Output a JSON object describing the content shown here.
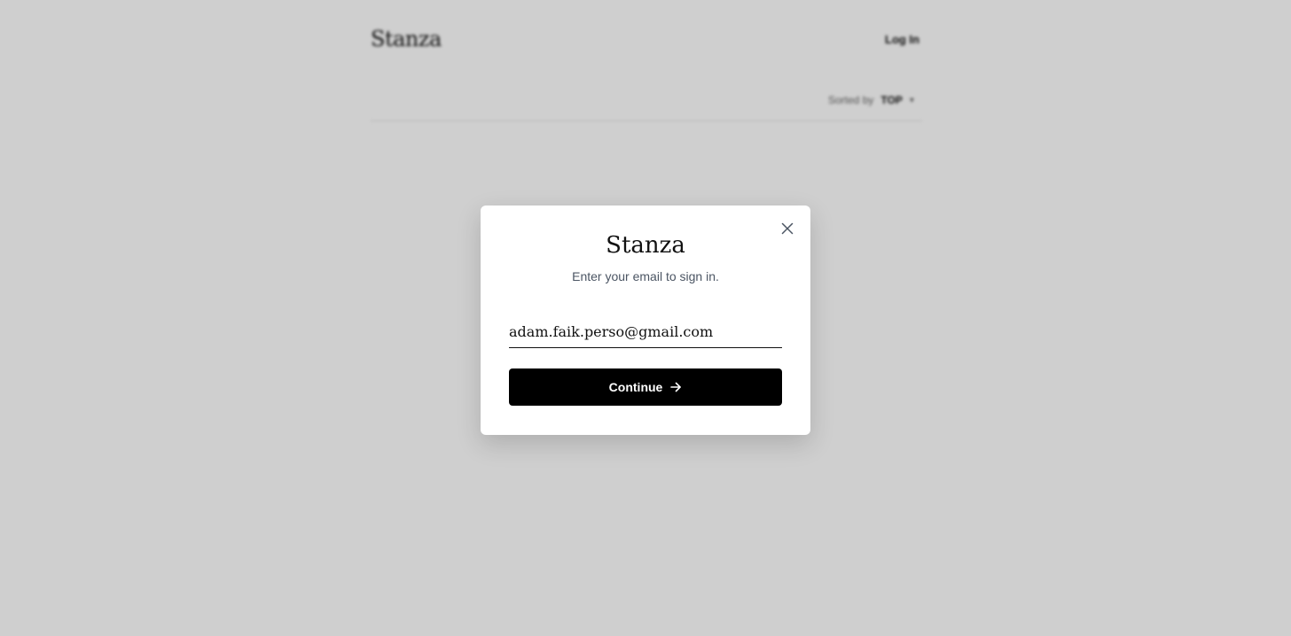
{
  "background": {
    "brand": "Stanza",
    "login_label": "Log In",
    "sort_label": "Sorted by",
    "sort_value": "TOP"
  },
  "modal": {
    "title": "Stanza",
    "subtitle": "Enter your email to sign in.",
    "email_value": "adam.faik.perso@gmail.com",
    "continue_label": "Continue",
    "close_icon": "close-icon",
    "arrow_icon": "arrow-right-icon"
  },
  "colors": {
    "button_bg": "#000000",
    "overlay": "rgba(0,0,0,0.19)",
    "subtitle_text": "#4b5563"
  }
}
